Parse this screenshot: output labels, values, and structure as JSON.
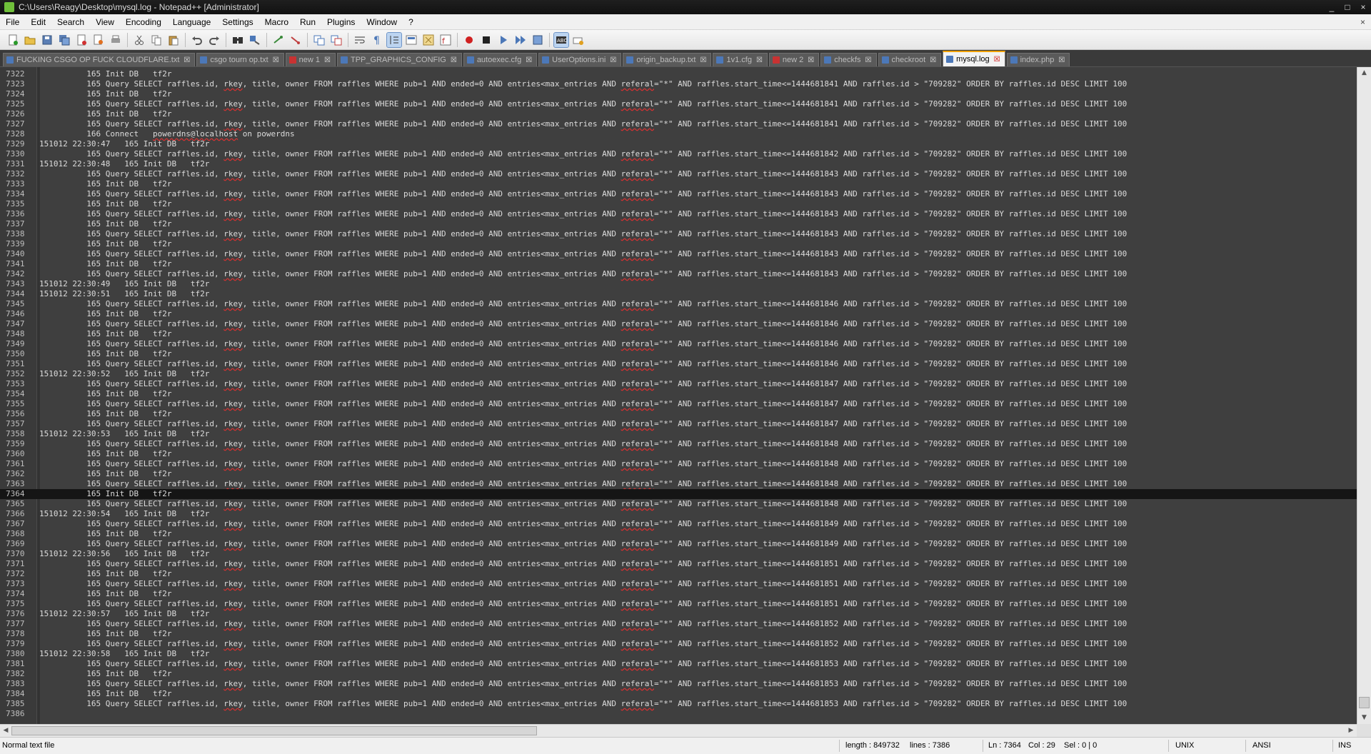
{
  "window": {
    "title": "C:\\Users\\Reagy\\Desktop\\mysql.log - Notepad++ [Administrator]",
    "controls": [
      "_",
      "□",
      "×"
    ],
    "menu_close": "×"
  },
  "menu": [
    "File",
    "Edit",
    "Search",
    "View",
    "Encoding",
    "Language",
    "Settings",
    "Macro",
    "Run",
    "Plugins",
    "Window",
    "?"
  ],
  "tabs": [
    {
      "label": "FUCKING CSGO OP FUCK CLOUDFLARE.txt",
      "unsaved": false,
      "active": false
    },
    {
      "label": "csgo tourn op.txt",
      "unsaved": false,
      "active": false
    },
    {
      "label": "new  1",
      "unsaved": true,
      "active": false
    },
    {
      "label": "TPP_GRAPHICS_CONFIG",
      "unsaved": false,
      "active": false
    },
    {
      "label": "autoexec.cfg",
      "unsaved": false,
      "active": false
    },
    {
      "label": "UserOptions.ini",
      "unsaved": false,
      "active": false
    },
    {
      "label": "origin_backup.txt",
      "unsaved": false,
      "active": false
    },
    {
      "label": "1v1.cfg",
      "unsaved": false,
      "active": false
    },
    {
      "label": "new  2",
      "unsaved": true,
      "active": false
    },
    {
      "label": "checkfs",
      "unsaved": false,
      "active": false
    },
    {
      "label": "checkroot",
      "unsaved": false,
      "active": false
    },
    {
      "label": "mysql.log",
      "unsaved": false,
      "active": true
    },
    {
      "label": "index.php",
      "unsaved": false,
      "active": false
    }
  ],
  "editor": {
    "first_line": 7322,
    "current_line": 7364,
    "lines": [
      {
        "t": "init",
        "ts": ""
      },
      {
        "t": "query",
        "n": "1444681841"
      },
      {
        "t": "init",
        "ts": ""
      },
      {
        "t": "query",
        "n": "1444681841"
      },
      {
        "t": "init",
        "ts": ""
      },
      {
        "t": "query",
        "n": "1444681841"
      },
      {
        "t": "connect"
      },
      {
        "t": "init",
        "ts": "151012 22:30:47"
      },
      {
        "t": "query",
        "n": "1444681842"
      },
      {
        "t": "init",
        "ts": "151012 22:30:48"
      },
      {
        "t": "query",
        "n": "1444681843"
      },
      {
        "t": "init",
        "ts": ""
      },
      {
        "t": "query",
        "n": "1444681843"
      },
      {
        "t": "init",
        "ts": ""
      },
      {
        "t": "query",
        "n": "1444681843"
      },
      {
        "t": "init",
        "ts": ""
      },
      {
        "t": "query",
        "n": "1444681843"
      },
      {
        "t": "init",
        "ts": ""
      },
      {
        "t": "query",
        "n": "1444681843"
      },
      {
        "t": "init",
        "ts": ""
      },
      {
        "t": "query",
        "n": "1444681843"
      },
      {
        "t": "init",
        "ts": "151012 22:30:49"
      },
      {
        "t": "init",
        "ts": "151012 22:30:51"
      },
      {
        "t": "query",
        "n": "1444681846"
      },
      {
        "t": "init",
        "ts": ""
      },
      {
        "t": "query",
        "n": "1444681846"
      },
      {
        "t": "init",
        "ts": ""
      },
      {
        "t": "query",
        "n": "1444681846"
      },
      {
        "t": "init",
        "ts": ""
      },
      {
        "t": "query",
        "n": "1444681846"
      },
      {
        "t": "init",
        "ts": "151012 22:30:52"
      },
      {
        "t": "query",
        "n": "1444681847"
      },
      {
        "t": "init",
        "ts": ""
      },
      {
        "t": "query",
        "n": "1444681847"
      },
      {
        "t": "init",
        "ts": ""
      },
      {
        "t": "query",
        "n": "1444681847"
      },
      {
        "t": "init",
        "ts": "151012 22:30:53"
      },
      {
        "t": "query",
        "n": "1444681848"
      },
      {
        "t": "init",
        "ts": ""
      },
      {
        "t": "query",
        "n": "1444681848"
      },
      {
        "t": "init",
        "ts": ""
      },
      {
        "t": "query",
        "n": "1444681848"
      },
      {
        "t": "init",
        "ts": ""
      },
      {
        "t": "query",
        "n": "1444681848"
      },
      {
        "t": "init",
        "ts": "151012 22:30:54"
      },
      {
        "t": "query",
        "n": "1444681849"
      },
      {
        "t": "init",
        "ts": ""
      },
      {
        "t": "query",
        "n": "1444681849"
      },
      {
        "t": "init",
        "ts": "151012 22:30:56"
      },
      {
        "t": "query",
        "n": "1444681851"
      },
      {
        "t": "init",
        "ts": ""
      },
      {
        "t": "query",
        "n": "1444681851"
      },
      {
        "t": "init",
        "ts": ""
      },
      {
        "t": "query",
        "n": "1444681851"
      },
      {
        "t": "init",
        "ts": "151012 22:30:57"
      },
      {
        "t": "query",
        "n": "1444681852"
      },
      {
        "t": "init",
        "ts": ""
      },
      {
        "t": "query",
        "n": "1444681852"
      },
      {
        "t": "init",
        "ts": "151012 22:30:58"
      },
      {
        "t": "query",
        "n": "1444681853"
      },
      {
        "t": "init",
        "ts": ""
      },
      {
        "t": "query",
        "n": "1444681853"
      },
      {
        "t": "init",
        "ts": ""
      },
      {
        "t": "query",
        "n": "1444681853"
      },
      {
        "t": "empty"
      }
    ],
    "templates": {
      "init": "165 Init DB   tf2r",
      "query_a": "165 Query SELECT raffles.id, ",
      "query_rkey": "rkey",
      "query_b": ", title, owner FROM raffles WHERE pub=1 AND ended=0 AND entries<max_entries AND ",
      "query_referal": "referal",
      "query_c": "=\"*\" AND raffles.start_time<=",
      "query_d": " AND raffles.id > \"709282\" ORDER BY raffles.id DESC LIMIT 100",
      "connect_a": "166 Connect   ",
      "connect_b": "powerdns@localhost",
      "connect_c": " on powerdns"
    }
  },
  "statusbar": {
    "filetype": "Normal text file",
    "length": "length : 849732",
    "lines": "lines : 7386",
    "ln": "Ln : 7364",
    "col": "Col : 29",
    "sel": "Sel : 0 | 0",
    "eol": "UNIX",
    "encoding": "ANSI",
    "mode": "INS"
  },
  "colors": {
    "editor_bg": "#3f3f3f",
    "text": "#dcdcdc",
    "active_tab_accent": "#f0a000",
    "squiggle": "#e03030"
  }
}
